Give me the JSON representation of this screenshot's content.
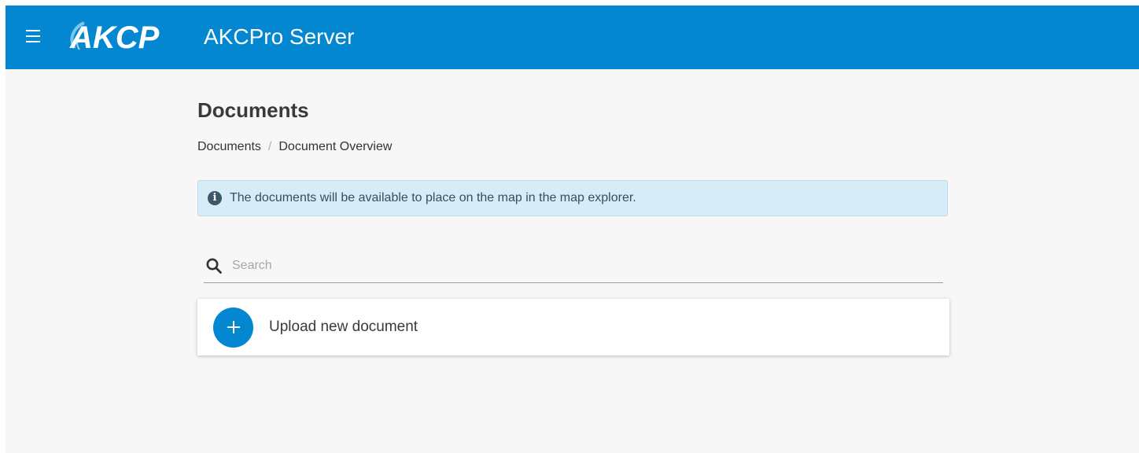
{
  "header": {
    "menu_icon": "hamburger-menu-icon",
    "logo_text": "AKCP",
    "app_title": "AKCPro Server",
    "accent_color": "#0387d1"
  },
  "page": {
    "title": "Documents",
    "breadcrumb": [
      "Documents",
      "Document Overview"
    ]
  },
  "info_alert": {
    "icon": "info-icon",
    "text": "The documents will be available to place on the map in the map explorer."
  },
  "search": {
    "icon": "search-icon",
    "placeholder": "Search",
    "value": ""
  },
  "upload": {
    "icon": "plus-icon",
    "label": "Upload new document"
  }
}
